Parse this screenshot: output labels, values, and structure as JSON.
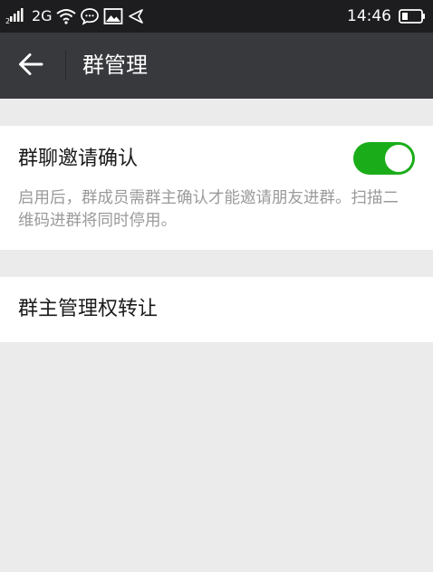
{
  "status_bar": {
    "sim_label": "2",
    "network": "2G",
    "time": "14:46",
    "icons": [
      "signal-icon",
      "wifi-icon",
      "chat-bubble-icon",
      "image-icon",
      "location-arrow-icon",
      "battery-icon"
    ]
  },
  "header": {
    "title": "群管理",
    "back_icon": "arrow-left-icon",
    "background": "#38393d"
  },
  "settings": {
    "invite_confirm": {
      "label": "群聊邀请确认",
      "enabled": true,
      "description": "启用后，群成员需群主确认才能邀请朋友进群。扫描二维码进群将同时停用。",
      "toggle_color": "#1aad19"
    },
    "transfer_owner": {
      "label": "群主管理权转让"
    }
  }
}
